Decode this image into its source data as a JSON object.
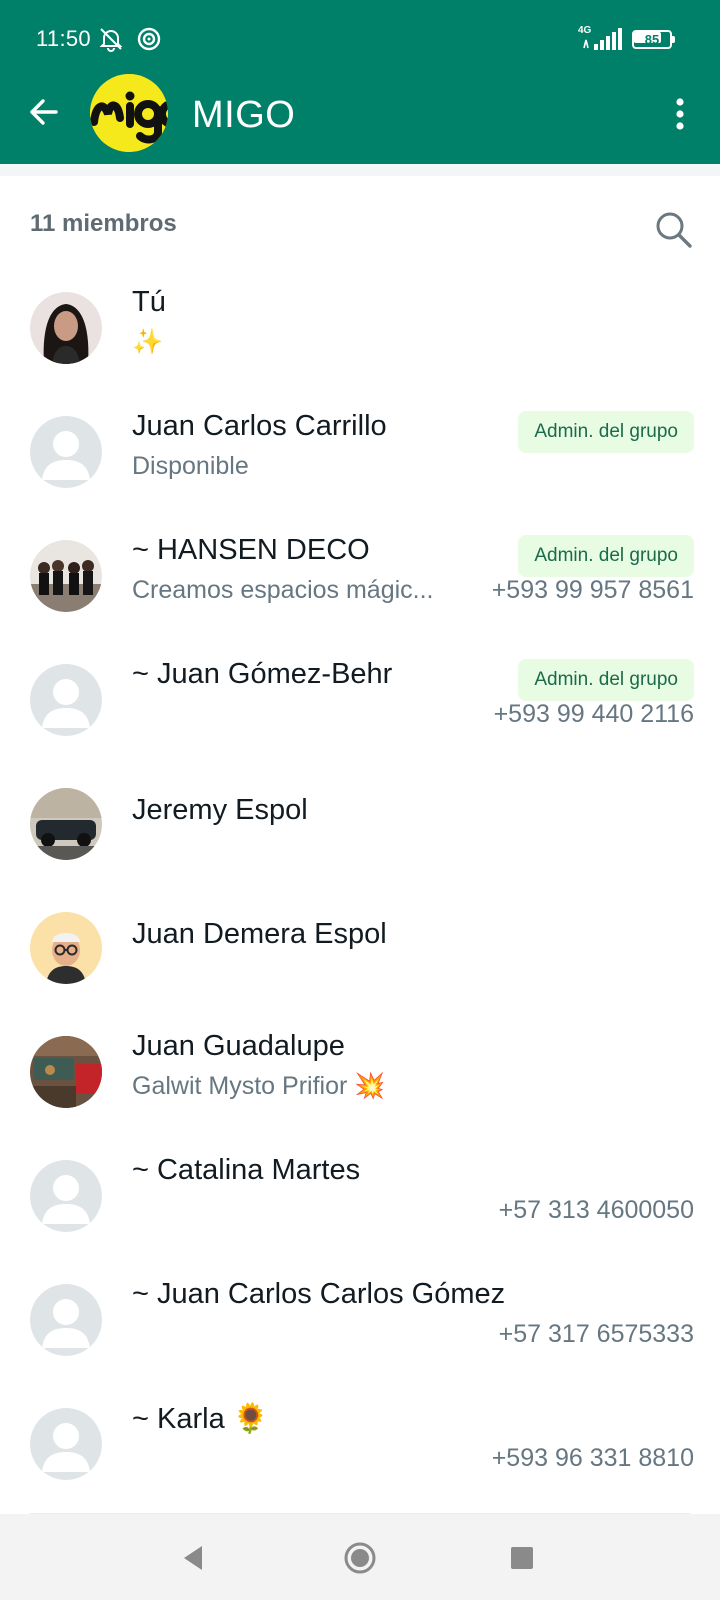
{
  "status_bar": {
    "time": "11:50",
    "network": "4G",
    "battery": "85",
    "battery_level": 0.85
  },
  "app_bar": {
    "title": "MIGO",
    "avatar_text": "migo"
  },
  "members_section": {
    "count_label": "11 miembros"
  },
  "members": [
    {
      "name": "Tú",
      "subtitle": "✨",
      "admin": "",
      "phone": "",
      "avatar": "photo-woman"
    },
    {
      "name": "Juan Carlos Carrillo",
      "subtitle": "Disponible",
      "admin": "Admin. del grupo",
      "phone": "",
      "avatar": "default"
    },
    {
      "name": "~ HANSEN DECO",
      "subtitle": "Creamos espacios mágic...",
      "admin": "Admin. del grupo",
      "phone": "+593 99 957 8561",
      "avatar": "photo-group"
    },
    {
      "name": "~ Juan Gómez-Behr",
      "subtitle": "",
      "admin": "Admin. del grupo",
      "phone": "+593 99 440 2116",
      "avatar": "default"
    },
    {
      "name": "Jeremy Espol",
      "subtitle": "",
      "admin": "",
      "phone": "",
      "avatar": "photo-car"
    },
    {
      "name": "Juan Demera Espol",
      "subtitle": "",
      "admin": "",
      "phone": "",
      "avatar": "photo-memoji"
    },
    {
      "name": "Juan Guadalupe",
      "subtitle": "Galwit Mysto Prifior 💥",
      "admin": "",
      "phone": "",
      "avatar": "photo-workshop"
    },
    {
      "name": "~ Catalina Martes",
      "subtitle": "",
      "admin": "",
      "phone": "+57 313 4600050",
      "avatar": "default"
    },
    {
      "name": "~ Juan Carlos Carlos Gómez",
      "subtitle": "",
      "admin": "",
      "phone": "+57 317 6575333",
      "avatar": "default"
    },
    {
      "name": "~ Karla 🌻",
      "subtitle": "",
      "admin": "",
      "phone": "+593 96 331 8810",
      "avatar": "default"
    }
  ],
  "icons": {
    "back": "arrow-left-icon",
    "more": "more-vert-icon",
    "search": "search-icon",
    "nav_back": "triangle-back-icon",
    "nav_home": "circle-home-icon",
    "nav_recents": "square-recents-icon"
  },
  "colors": {
    "header": "#008069",
    "admin_badge_bg": "#e7fce3",
    "admin_badge_text": "#1b6b4b",
    "secondary_text": "#667781"
  }
}
